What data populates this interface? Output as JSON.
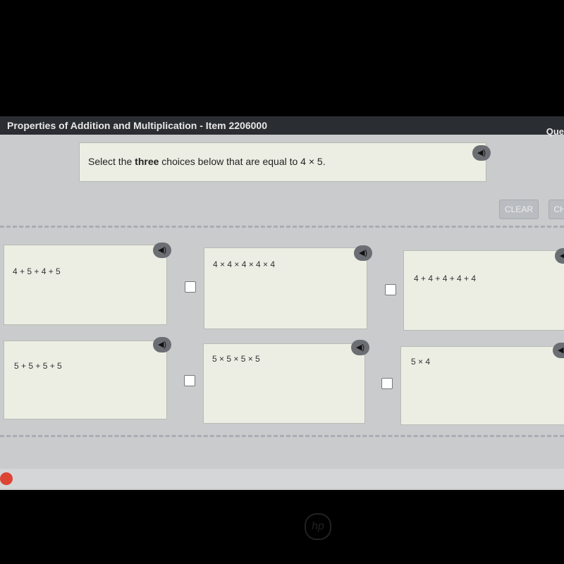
{
  "header": {
    "title": "Properties of Addition and Multiplication - Item 2206000",
    "right_label": "Que"
  },
  "prompt": {
    "pre": "Select the ",
    "bold": "three",
    "post": " choices below that are equal to 4 × 5."
  },
  "toolbar": {
    "clear_label": "CLEAR",
    "second_label": "CH"
  },
  "choices": [
    {
      "text": "4 + 5 + 4 + 5",
      "checked": false
    },
    {
      "text": "4 × 4 × 4 × 4 × 4",
      "checked": false
    },
    {
      "text": "4 + 4 + 4 + 4 + 4",
      "checked": false
    },
    {
      "text": "5 + 5 + 5 + 5",
      "checked": false
    },
    {
      "text": "5 × 5 × 5 × 5",
      "checked": false
    },
    {
      "text": "5 × 4",
      "checked": false
    }
  ],
  "icons": {
    "speaker": "speaker-icon",
    "browser": "chrome-icon",
    "logo": "hp"
  }
}
